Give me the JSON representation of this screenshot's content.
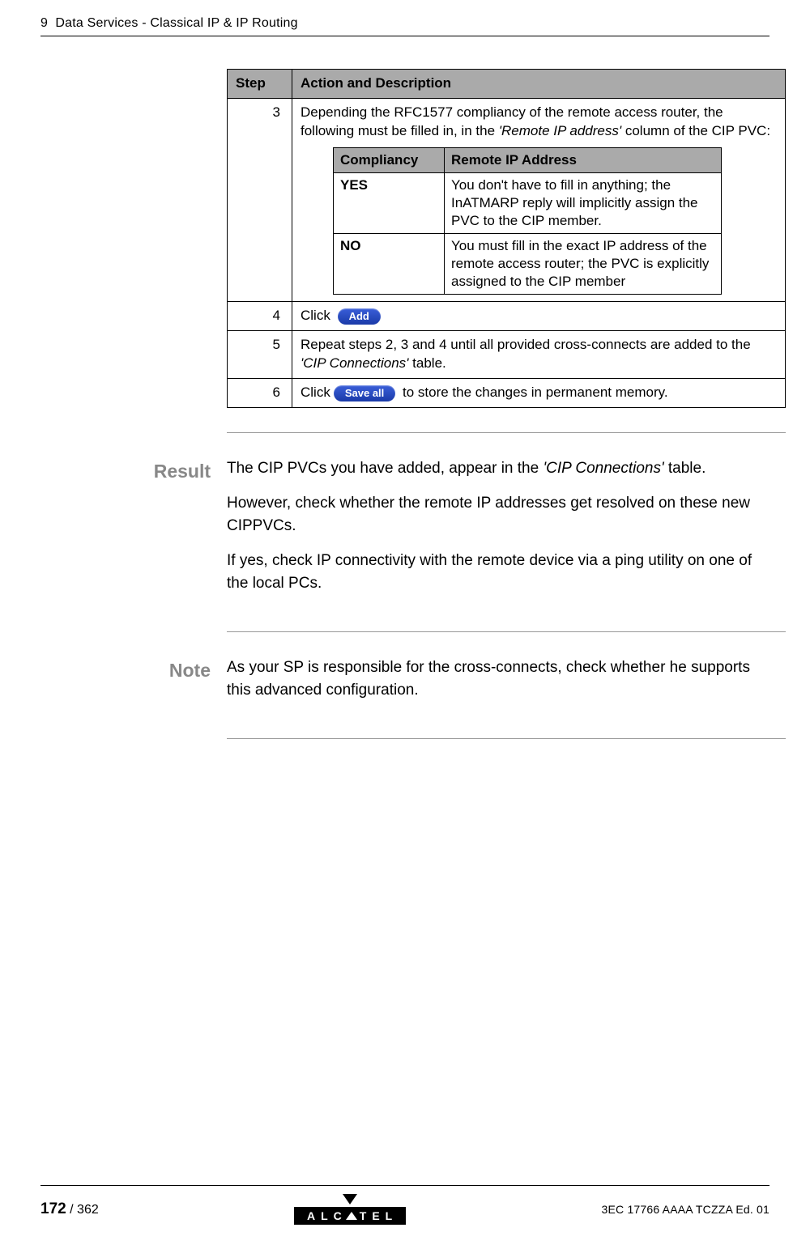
{
  "header": {
    "chapter_num": "9",
    "chapter_title": "Data Services - Classical IP & IP Routing"
  },
  "steps_table": {
    "headers": {
      "step": "Step",
      "action": "Action and Description"
    },
    "rows": [
      {
        "num": "3",
        "desc_pre": "Depending the RFC1577 compliancy of the remote access router, the following must be filled in, in the ",
        "desc_em": "'Remote IP address'",
        "desc_post": " column of the CIP PVC:",
        "inner": {
          "headers": {
            "c": "Compliancy",
            "r": "Remote IP Address"
          },
          "rows": [
            {
              "c": "YES",
              "r": "You don't have to fill in anything; the InATMARP reply will implicitly assign the PVC to the CIP member."
            },
            {
              "c": "NO",
              "r": "You must fill in the exact IP address of the remote access router; the PVC is explicitly assigned to the CIP member"
            }
          ]
        }
      },
      {
        "num": "4",
        "desc_pre": "Click ",
        "button": "Add"
      },
      {
        "num": "5",
        "desc_pre": "Repeat steps 2, 3 and 4 until all provided cross-connects are added to the ",
        "desc_em": "'CIP Connections'",
        "desc_post": " table."
      },
      {
        "num": "6",
        "desc_pre": "Click",
        "button": "Save all",
        "desc_post": " to store the changes in permanent memory."
      }
    ]
  },
  "sections": {
    "result": {
      "label": "Result",
      "p1_a": "The CIP PVCs you have added, appear in the ",
      "p1_em": "'CIP Connections'",
      "p1_b": " table.",
      "p2": "However, check whether the remote IP addresses get resolved on these new CIPPVCs.",
      "p3": "If yes, check IP connectivity with the remote device via a ping utility on one of the local PCs."
    },
    "note": {
      "label": "Note",
      "p1": "As your SP is responsible for the cross-connects, check whether he supports this advanced configuration."
    }
  },
  "footer": {
    "page": "172",
    "sep": " / ",
    "total": "362",
    "logo_text_a": "ALC",
    "logo_text_b": "TEL",
    "docid": "3EC 17766 AAAA TCZZA Ed. 01"
  }
}
